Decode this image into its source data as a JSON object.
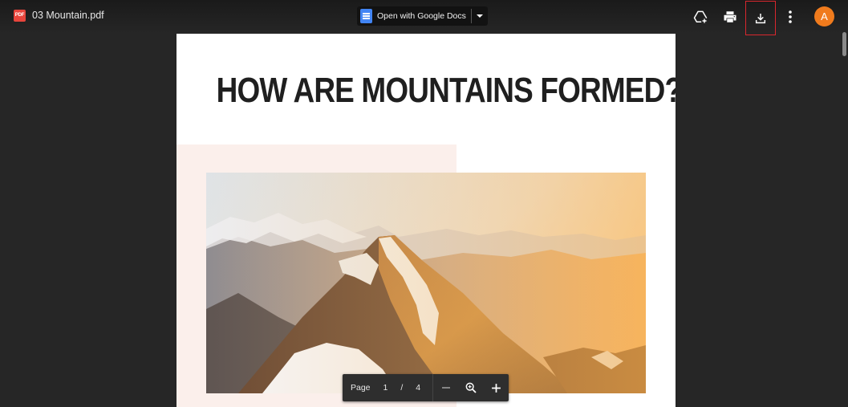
{
  "file": {
    "icon_label": "PDF",
    "name": "03 Mountain.pdf"
  },
  "open_with": {
    "label": "Open with Google Docs"
  },
  "toolbar": {
    "icons": [
      "add-to-drive-icon",
      "print-icon",
      "download-icon",
      "more-vert-icon"
    ],
    "highlight_color": "#d9272e"
  },
  "account": {
    "avatar_letter": "A",
    "avatar_color": "#f07b1d"
  },
  "document": {
    "title": "HOW ARE MOUNTAINS FORMED?"
  },
  "page_nav": {
    "page_label": "Page",
    "current_page": "1",
    "separator": "/",
    "total_pages": "4"
  }
}
